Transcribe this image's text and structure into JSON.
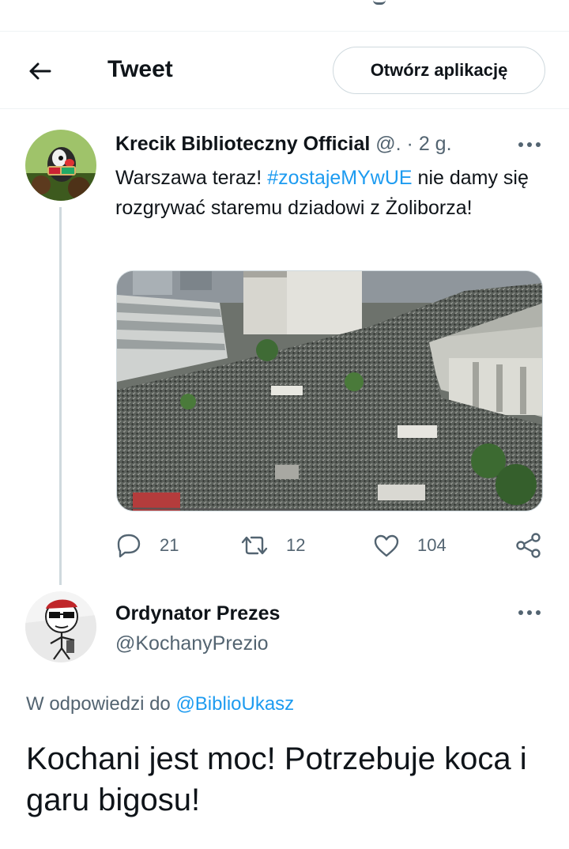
{
  "header": {
    "title": "Tweet",
    "open_app_label": "Otwórz aplikację"
  },
  "tweet1": {
    "author_name": "Krecik Biblioteczny Official",
    "handle_meta": "@. · 2 g.",
    "text_before": "Warszawa teraz! ",
    "hashtag": "#zostajeMYwUE",
    "text_after": " nie damy się rozgrywać staremu dziadowi z Żoliborza!",
    "stats": {
      "replies": "21",
      "retweets": "12",
      "likes": "104"
    }
  },
  "tweet2": {
    "author_name": "Ordynator Prezes",
    "handle": "@KochanyPrezio",
    "reply_prefix": "W odpowiedzi do ",
    "reply_mention": "@BiblioUkasz",
    "text": "Kochani jest moc! Potrzebuje koca i garu bigosu!"
  },
  "colors": {
    "accent": "#1d9bf0",
    "text_primary": "#0f1419",
    "text_secondary": "#536471",
    "border": "#cfd9de"
  },
  "icons": [
    "back-arrow-icon",
    "more-dots-icon",
    "reply-icon",
    "retweet-icon",
    "like-icon",
    "share-icon"
  ]
}
